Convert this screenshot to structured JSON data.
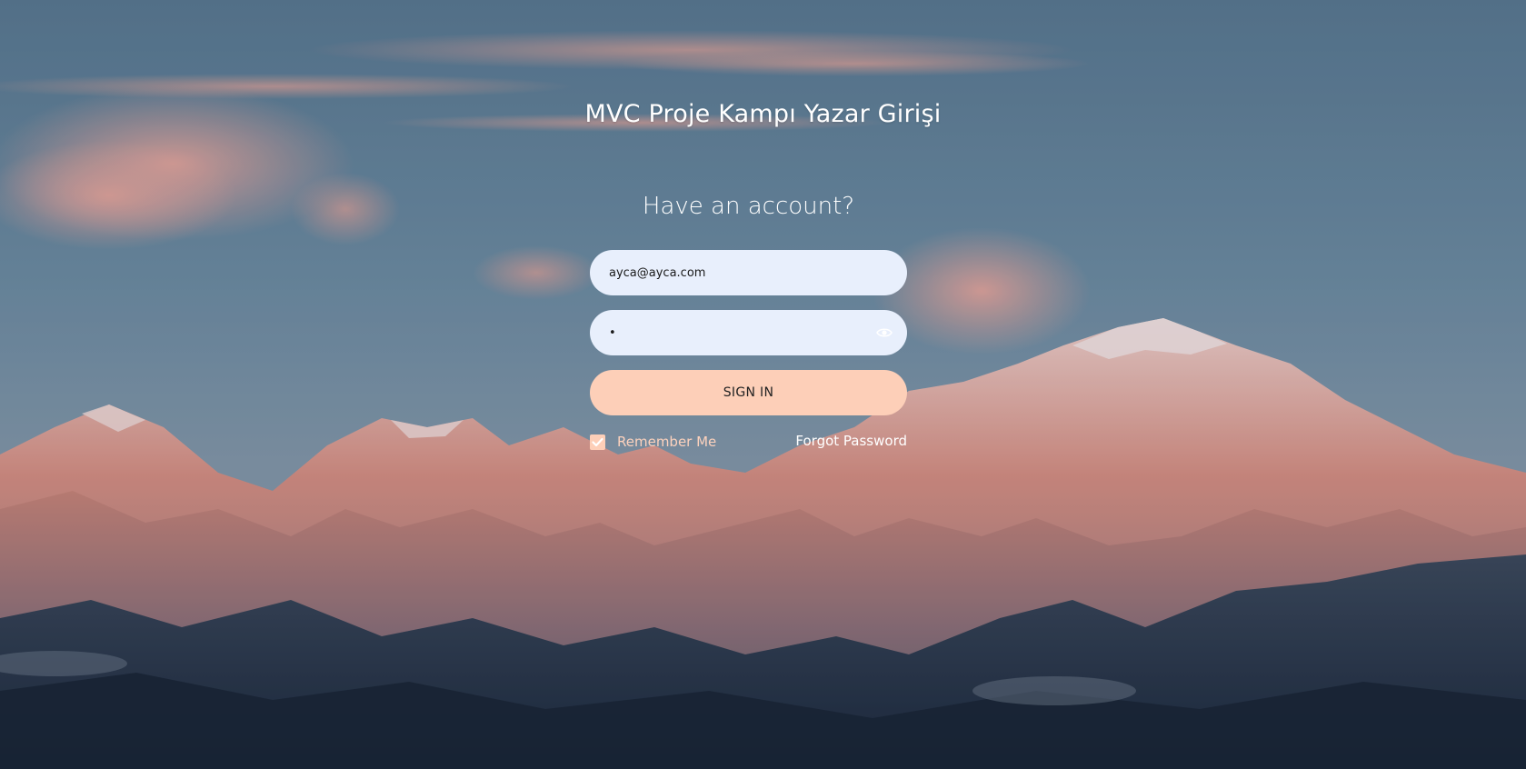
{
  "page": {
    "title": "MVC Proje Kampı Yazar Girişi",
    "background_description_icon": "mountain-landscape-background"
  },
  "login": {
    "heading": "Have an account?",
    "email_value": "ayca@ayca.com",
    "password_value": "•",
    "password_toggle_icon": "eye-icon",
    "signin_label": "SIGN IN",
    "remember_label": "Remember Me",
    "remember_checked": true,
    "forgot_label": "Forgot Password"
  },
  "colors": {
    "field_bg": "#e8effc",
    "button_bg": "#fdcfb8",
    "remember_text": "#fdd2bd",
    "title_text": "#ffffff"
  }
}
